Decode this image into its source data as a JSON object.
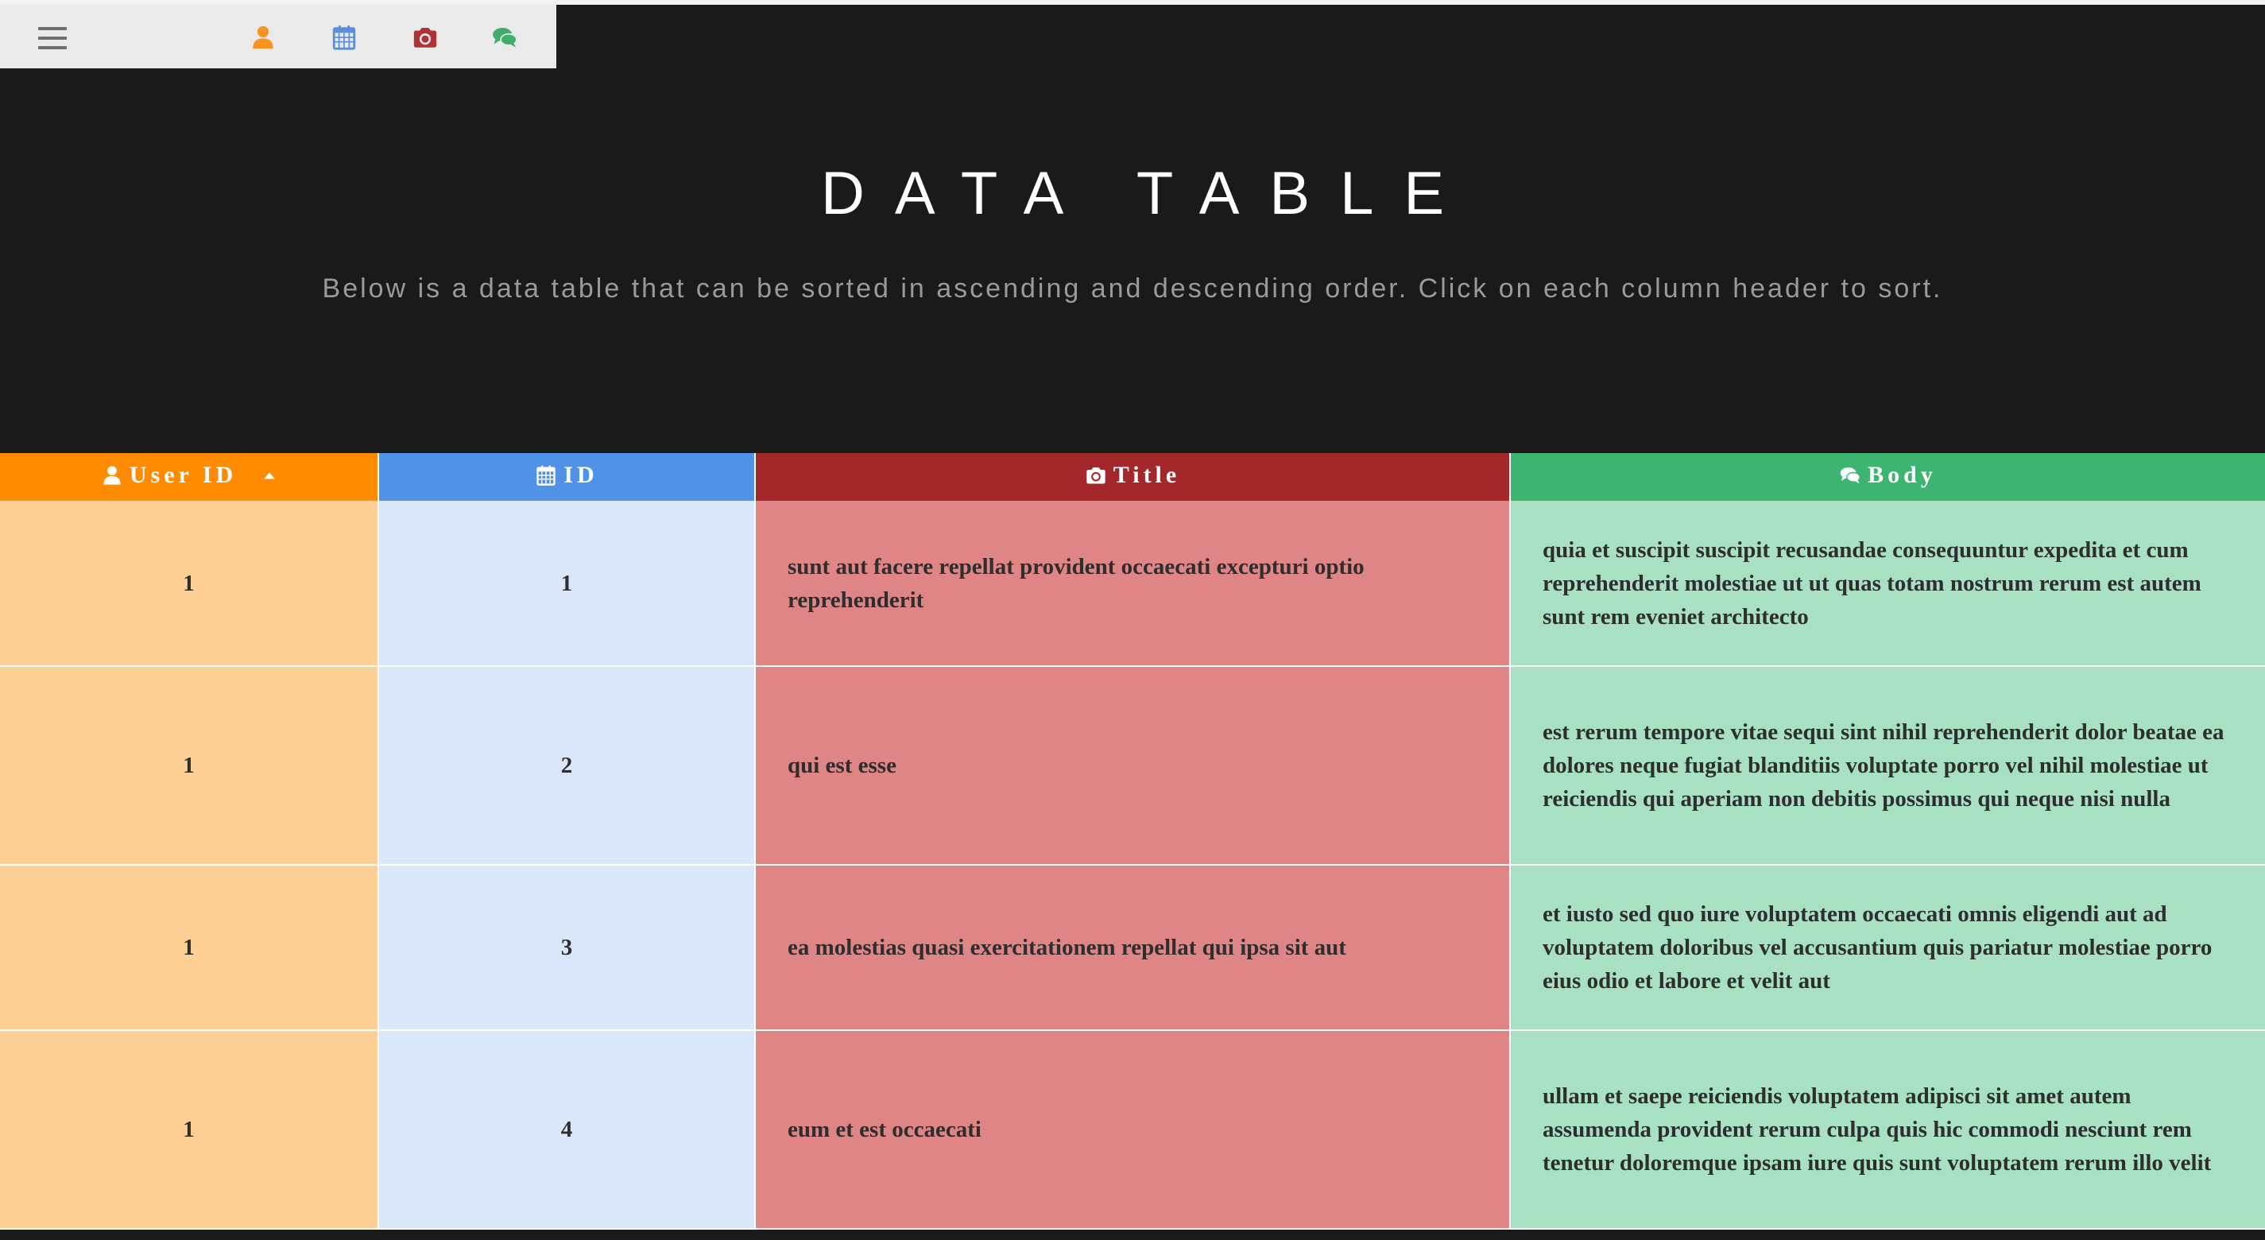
{
  "navbar": {
    "menu_icon": "hamburger-menu-icon",
    "icons": [
      {
        "name": "user-icon",
        "color": "#f7931e"
      },
      {
        "name": "calendar-icon",
        "color": "#5b8fd8"
      },
      {
        "name": "camera-icon",
        "color": "#b03236"
      },
      {
        "name": "comments-icon",
        "color": "#3fae6a"
      }
    ]
  },
  "hero": {
    "title": "DATA TABLE",
    "subtitle": "Below is a data table that can be sorted in ascending and descending order. Click on each column header to sort."
  },
  "table": {
    "columns": [
      {
        "label": "User ID",
        "icon": "user-icon",
        "color": "#ff8b00",
        "sorted": "ascending"
      },
      {
        "label": "ID",
        "icon": "calendar-icon",
        "color": "#5092e8"
      },
      {
        "label": "Title",
        "icon": "camera-icon",
        "color": "#a2282b"
      },
      {
        "label": "Body",
        "icon": "comments-icon",
        "color": "#3db571"
      }
    ],
    "rows": [
      {
        "userId": "1",
        "id": "1",
        "title": "sunt aut facere repellat provident occaecati excepturi optio reprehenderit",
        "body": "quia et suscipit suscipit recusandae consequuntur expedita et cum reprehenderit molestiae ut ut quas totam nostrum rerum est autem sunt rem eveniet architecto"
      },
      {
        "userId": "1",
        "id": "2",
        "title": "qui est esse",
        "body": "est rerum tempore vitae sequi sint nihil reprehenderit dolor beatae ea dolores neque fugiat blanditiis voluptate porro vel nihil molestiae ut reiciendis qui aperiam non debitis possimus qui neque nisi nulla"
      },
      {
        "userId": "1",
        "id": "3",
        "title": "ea molestias quasi exercitationem repellat qui ipsa sit aut",
        "body": "et iusto sed quo iure voluptatem occaecati omnis eligendi aut ad voluptatem doloribus vel accusantium quis pariatur molestiae porro eius odio et labore et velit aut"
      },
      {
        "userId": "1",
        "id": "4",
        "title": "eum et est occaecati",
        "body": "ullam et saepe reiciendis voluptatem adipisci sit amet autem assumenda provident rerum culpa quis hic commodi nesciunt rem tenetur doloremque ipsam iure quis sunt voluptatem rerum illo velit"
      }
    ]
  }
}
